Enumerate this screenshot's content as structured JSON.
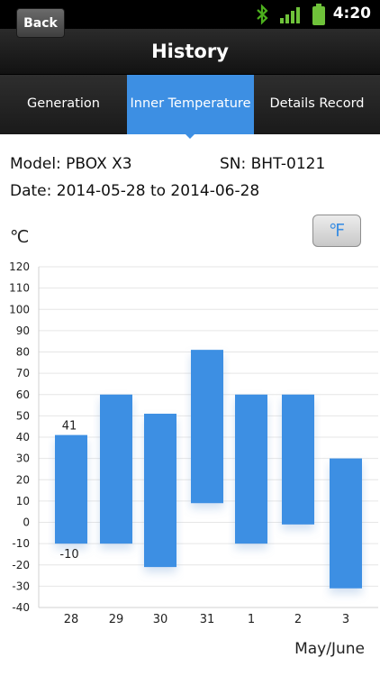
{
  "status_bar": {
    "time": "4:20",
    "icons": [
      "bluetooth-icon",
      "signal-icon",
      "battery-icon"
    ]
  },
  "header": {
    "back_label": "Back",
    "title": "History"
  },
  "tabs": [
    {
      "label": "Generation",
      "active": false
    },
    {
      "label": "Inner Temperature",
      "active": true
    },
    {
      "label": "Details Record",
      "active": false
    }
  ],
  "info": {
    "model": "Model: PBOX X3",
    "sn": "SN: BHT-0121",
    "date": "Date: 2014-05-28 to 2014-06-28"
  },
  "unit_label": "℃",
  "toggle_unit_label": "℉",
  "x_axis_label": "May/June",
  "colors": {
    "accent": "#3d8fe3",
    "bar": "#3d8fe3",
    "grid": "#e6e6e6"
  },
  "chart_data": {
    "type": "bar",
    "subtype": "floating-range",
    "categories": [
      "28",
      "29",
      "30",
      "31",
      "1",
      "2",
      "3"
    ],
    "series": [
      {
        "low": [
          -10,
          -10,
          -21,
          9,
          -10,
          -1,
          -31
        ],
        "high": [
          41,
          60,
          51,
          81,
          60,
          60,
          30
        ]
      }
    ],
    "data_labels": [
      {
        "category": "28",
        "high": "41",
        "low": "-10"
      }
    ],
    "yticks": [
      120,
      110,
      100,
      90,
      80,
      70,
      60,
      50,
      40,
      30,
      20,
      10,
      0,
      -10,
      -20,
      -30,
      -40
    ],
    "ylim": [
      -40,
      120
    ],
    "xlabel": "May/June",
    "ylabel": "℃",
    "grid": true
  }
}
